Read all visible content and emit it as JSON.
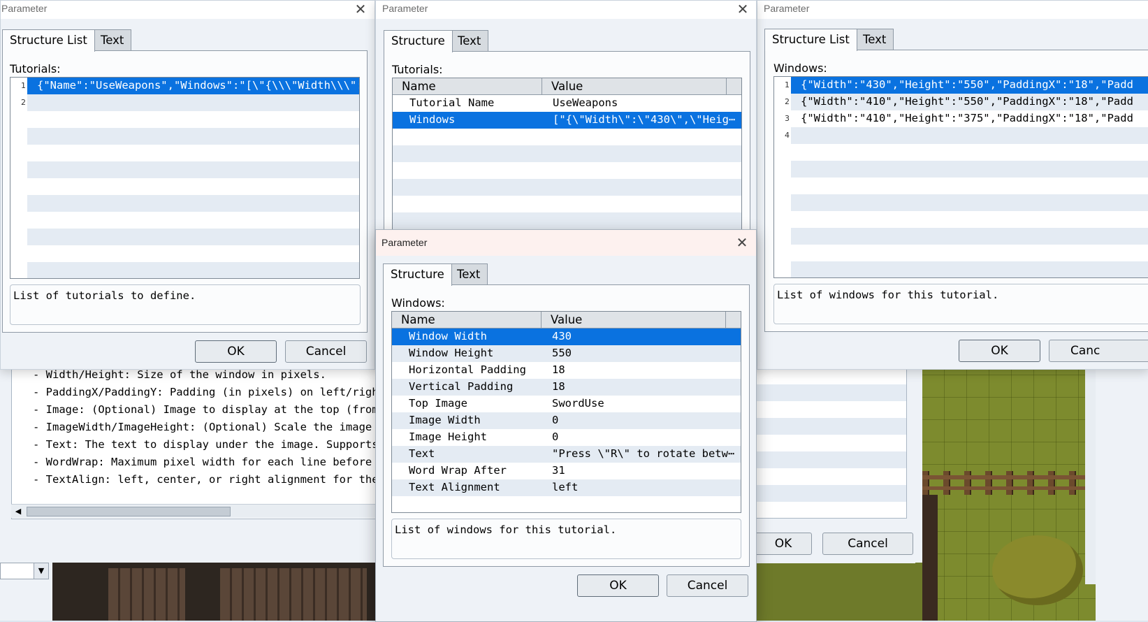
{
  "background": {
    "help_lines": [
      "- Width/Height: Size of the window in pixels.",
      "- PaddingX/PaddingY: Padding (in pixels) on left/right and",
      "- Image: (Optional) Image to display at the top (from img/p",
      "- ImageWidth/ImageHeight: (Optional) Scale the image to thi",
      "- Text: The text to display under the image. Supports word",
      "- WordWrap: Maximum pixel width for each line before wrappi",
      "- TextAlign: left, center, or right alignment for the text"
    ],
    "ok_label": "OK",
    "cancel_label": "Cancel"
  },
  "dialog1": {
    "title": "Parameter",
    "tabs": [
      "Structure List",
      "Text"
    ],
    "list_label": "Tutorials:",
    "rows": [
      {
        "n": "1",
        "text": "{\"Name\":\"UseWeapons\",\"Windows\":\"[\\\"{\\\\\\\"Width\\\\\\\":\\\\⋯"
      },
      {
        "n": "2",
        "text": ""
      }
    ],
    "description": "List of tutorials to define.",
    "ok_label": "OK",
    "cancel_label": "Cancel"
  },
  "dialog2": {
    "title": "Parameter",
    "tabs": [
      "Structure",
      "Text"
    ],
    "list_label": "Tutorials:",
    "columns": [
      "Name",
      "Value"
    ],
    "rows": [
      {
        "name": "Tutorial Name",
        "value": "UseWeapons"
      },
      {
        "name": "Windows",
        "value": "[\"{\\\"Width\\\":\\\"430\\\",\\\"Heig⋯"
      }
    ]
  },
  "dialog3": {
    "title": "Parameter",
    "tabs": [
      "Structure List",
      "Text"
    ],
    "list_label": "Windows:",
    "rows": [
      {
        "n": "1",
        "text": "{\"Width\":\"430\",\"Height\":\"550\",\"PaddingX\":\"18\",\"Padd"
      },
      {
        "n": "2",
        "text": "{\"Width\":\"410\",\"Height\":\"550\",\"PaddingX\":\"18\",\"Padd"
      },
      {
        "n": "3",
        "text": "{\"Width\":\"410\",\"Height\":\"375\",\"PaddingX\":\"18\",\"Padd"
      },
      {
        "n": "4",
        "text": ""
      }
    ],
    "description": "List of windows for this tutorial.",
    "ok_label": "OK",
    "cancel_label": "Canc"
  },
  "dialog4": {
    "title": "Parameter",
    "tabs": [
      "Structure",
      "Text"
    ],
    "list_label": "Windows:",
    "columns": [
      "Name",
      "Value"
    ],
    "rows": [
      {
        "name": "Window Width",
        "value": "430"
      },
      {
        "name": "Window Height",
        "value": "550"
      },
      {
        "name": "Horizontal Padding",
        "value": "18"
      },
      {
        "name": "Vertical Padding",
        "value": "18"
      },
      {
        "name": "Top Image",
        "value": "SwordUse"
      },
      {
        "name": "Image Width",
        "value": "0"
      },
      {
        "name": "Image Height",
        "value": "0"
      },
      {
        "name": "Text",
        "value": "\"Press \\\"R\\\" to rotate betw⋯"
      },
      {
        "name": "Word Wrap After",
        "value": "31"
      },
      {
        "name": "Text Alignment",
        "value": "left"
      }
    ],
    "description": "List of windows for this tutorial.",
    "ok_label": "OK",
    "cancel_label": "Cancel"
  },
  "colors": {
    "selection": "#0a72e0",
    "dialog_bg": "#eef2f7",
    "alt_row": "#e4ebf3"
  }
}
